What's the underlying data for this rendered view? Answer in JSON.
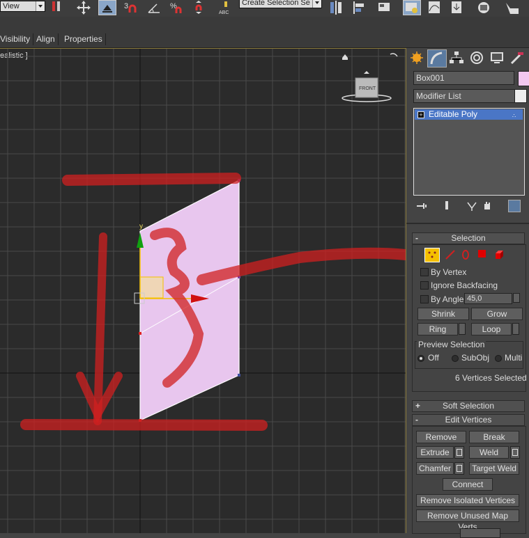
{
  "toolbar": {
    "view_dropdown": "View",
    "selection_set_dropdown": "Create Selection Se"
  },
  "ribbon_tabs": [
    "Visibility",
    "Align",
    "Properties"
  ],
  "viewport": {
    "shading_label": "ealistic ]",
    "viewcube_face": "FRONT",
    "axis_y": "y"
  },
  "panel": {
    "object_name": "Box001",
    "object_color": "#f2c8f0",
    "modifier_list": "Modifier List",
    "stack_item": "Editable Poly"
  },
  "selection": {
    "title": "Selection",
    "by_vertex": "By Vertex",
    "ignore_backfacing": "Ignore Backfacing",
    "by_angle": "By Angle:",
    "angle_value": "45,0",
    "shrink": "Shrink",
    "grow": "Grow",
    "ring": "Ring",
    "loop": "Loop",
    "preview_title": "Preview Selection",
    "preview_off": "Off",
    "preview_subobj": "SubObj",
    "preview_multi": "Multi",
    "status": "6 Vertices Selected"
  },
  "soft_selection": {
    "title": "Soft Selection"
  },
  "edit_vertices": {
    "title": "Edit Vertices",
    "remove": "Remove",
    "break": "Break",
    "extrude": "Extrude",
    "weld": "Weld",
    "chamfer": "Chamfer",
    "target_weld": "Target Weld",
    "connect": "Connect",
    "remove_isolated": "Remove Isolated Vertices",
    "remove_unused": "Remove Unused Map Verts"
  },
  "colors": {
    "selection_highlight": "#f5c000",
    "plane_fill": "#e8c6ee",
    "annotation_red": "#d02020"
  }
}
